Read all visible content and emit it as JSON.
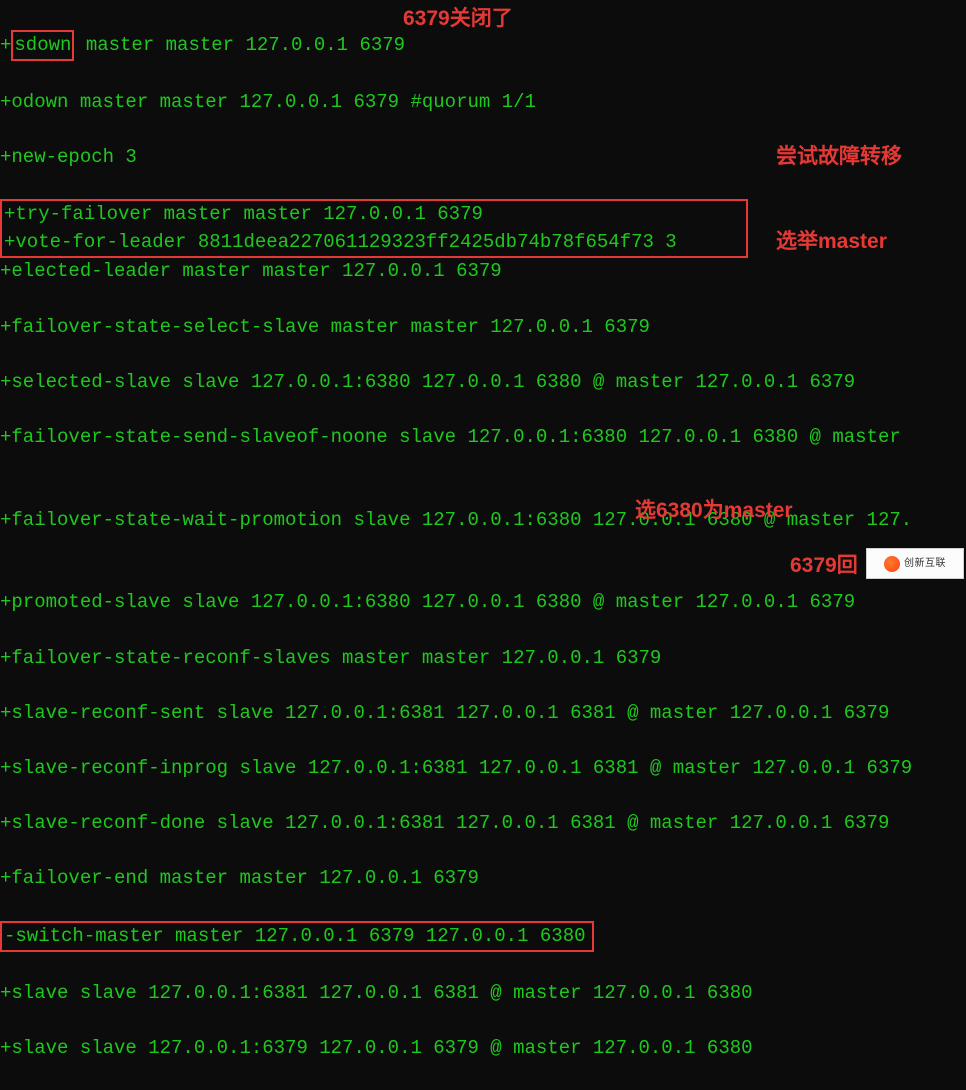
{
  "lines": {
    "l0_box": "sdown",
    "l0_rest": " master master 127.0.0.1 6379",
    "l1": "+odown master master 127.0.0.1 6379 #quorum 1/1",
    "l2": "+new-epoch 3",
    "l3": "+try-failover master master 127.0.0.1 6379",
    "l4": "+vote-for-leader 8811deea227061129323ff2425db74b78f654f73 3",
    "l5": "+elected-leader master master 127.0.0.1 6379",
    "l6": "+failover-state-select-slave master master 127.0.0.1 6379",
    "l7": "+selected-slave slave 127.0.0.1:6380 127.0.0.1 6380 @ master 127.0.0.1 6379",
    "l8": "+failover-state-send-slaveof-noone slave 127.0.0.1:6380 127.0.0.1 6380 @ master ",
    "blank": "",
    "l9": "+failover-state-wait-promotion slave 127.0.0.1:6380 127.0.0.1 6380 @ master 127.",
    "l10": "+promoted-slave slave 127.0.0.1:6380 127.0.0.1 6380 @ master 127.0.0.1 6379",
    "l11": "+failover-state-reconf-slaves master master 127.0.0.1 6379",
    "l12": "+slave-reconf-sent slave 127.0.0.1:6381 127.0.0.1 6381 @ master 127.0.0.1 6379",
    "l13": "+slave-reconf-inprog slave 127.0.0.1:6381 127.0.0.1 6381 @ master 127.0.0.1 6379",
    "l14": "+slave-reconf-done slave 127.0.0.1:6381 127.0.0.1 6381 @ master 127.0.0.1 6379",
    "l15": "+failover-end master master 127.0.0.1 6379",
    "l16": "-switch-master master 127.0.0.1 6379 127.0.0.1 6380",
    "l17": "+slave slave 127.0.0.1:6381 127.0.0.1 6381 @ master 127.0.0.1 6380",
    "l18": "+slave slave 127.0.0.1:6379 127.0.0.1 6379 @ master 127.0.0.1 6380"
  },
  "annotations": {
    "a1": "6379关闭了",
    "a2_line1": "尝试故障转移",
    "a2_line2": "选举master",
    "a3": "选6380为master",
    "a4": "6379回",
    "watermark": "创新互联"
  }
}
